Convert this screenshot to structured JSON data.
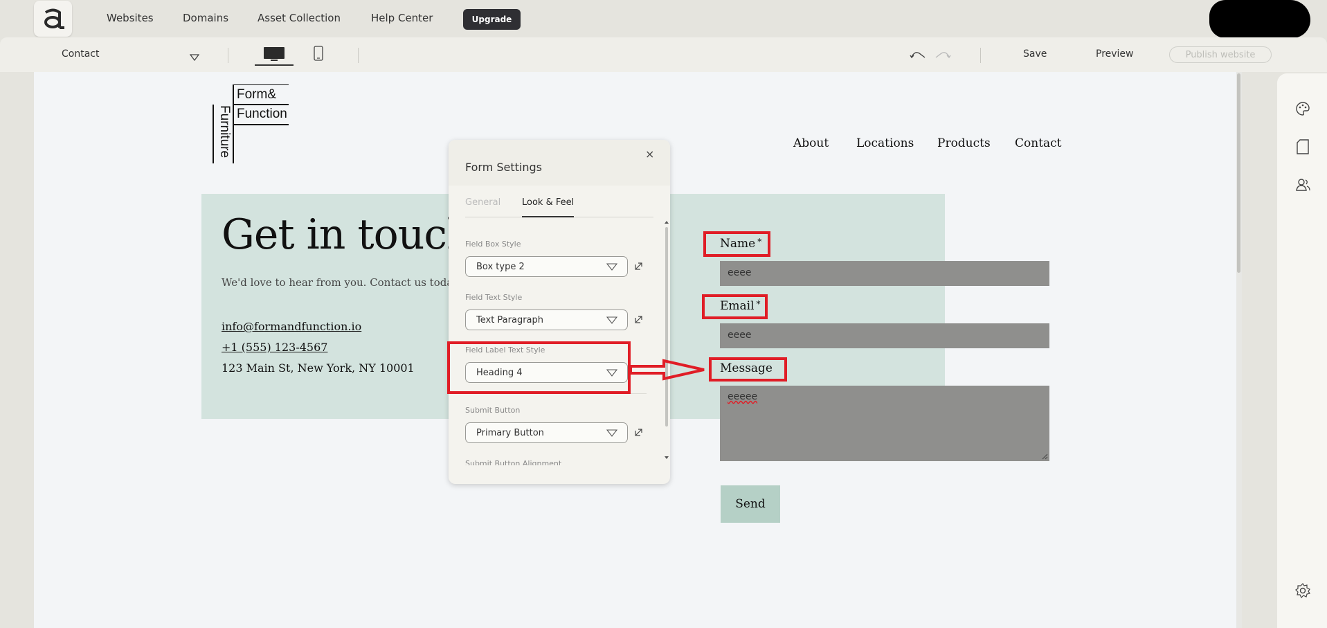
{
  "topnav": {
    "links": [
      "Websites",
      "Domains",
      "Asset Collection",
      "Help Center"
    ],
    "upgrade_label": "Upgrade"
  },
  "toolbar": {
    "page_select": "Contact",
    "save_label": "Save",
    "preview_label": "Preview",
    "publish_label": "Publish website"
  },
  "site": {
    "logo_lines": [
      "Form&",
      "Function",
      "Furniture"
    ],
    "nav": [
      "About",
      "Locations",
      "Products",
      "Contact"
    ],
    "hero_title": "Get in touch",
    "hero_subtitle": "We'd love to hear from you. Contact us today!",
    "email": "info@formandfunction.io",
    "phone": "+1 (555) 123-4567",
    "address": "123 Main St, New York, NY 10001",
    "form": {
      "name_label": "Name",
      "email_label": "Email",
      "message_label": "Message",
      "required_mark": "*",
      "name_value": "eeee",
      "email_value": "eeee",
      "message_value": "eeeee",
      "send_label": "Send"
    }
  },
  "popup": {
    "title": "Form Settings",
    "close_glyph": "×",
    "tabs": [
      "General",
      "Look & Feel"
    ],
    "sections": [
      {
        "label": "Field Box Style",
        "value": "Box type 2"
      },
      {
        "label": "Field Text Style",
        "value": "Text Paragraph"
      },
      {
        "label": "Field Label Text Style",
        "value": "Heading 4"
      },
      {
        "label": "Submit Button",
        "value": "Primary Button"
      },
      {
        "label": "Submit Button Alignment",
        "value": ""
      }
    ]
  },
  "colors": {
    "annotation_red": "#e01d26",
    "hero_bg": "#d3e3de",
    "input_bg": "#8f8f8d",
    "send_bg": "#b5d0c6",
    "upgrade_bg": "#2f2f33"
  }
}
